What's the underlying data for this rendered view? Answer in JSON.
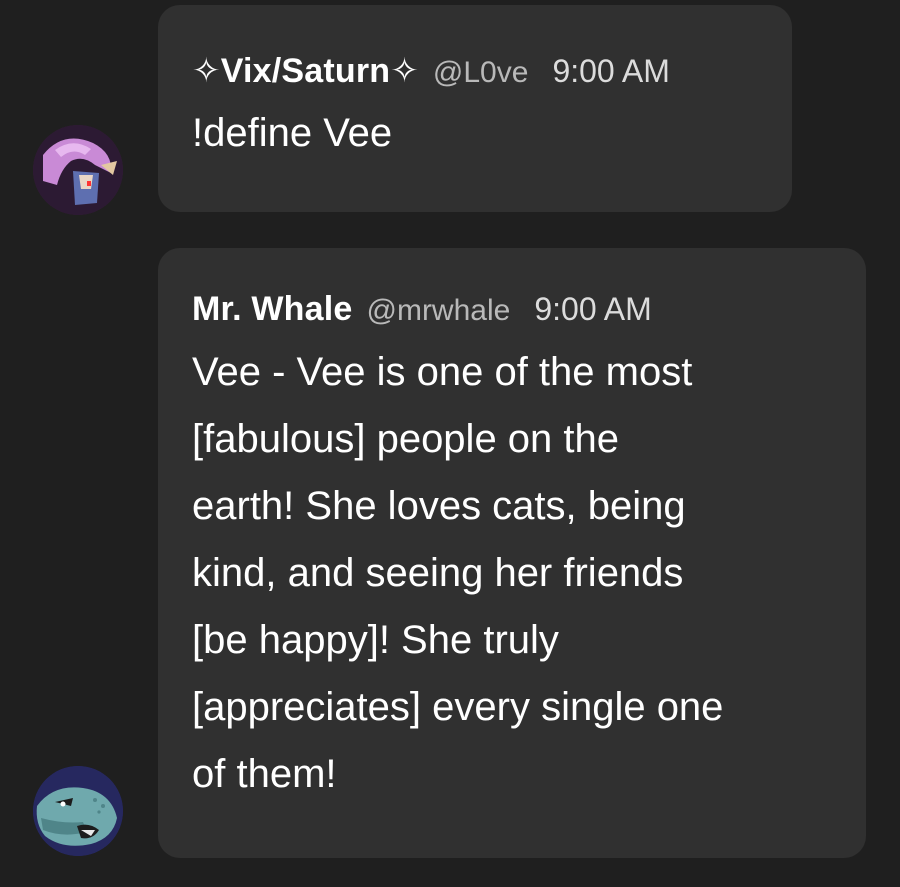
{
  "messages": [
    {
      "author": "✧Vix/Saturn✧",
      "handle": "@L0ve",
      "time": "9:00 AM",
      "content": "!define Vee",
      "avatar_icon": "pink-haired-character-avatar-icon"
    },
    {
      "author": "Mr. Whale",
      "handle": "@mrwhale",
      "time": "9:00 AM",
      "content": "Vee - Vee is one of the most\n[fabulous] people on the\nearth! She loves cats, being\nkind, and seeing her friends\n[be happy]! She truly\n[appreciates] every single one\nof them!",
      "avatar_icon": "whale-avatar-icon"
    }
  ],
  "colors": {
    "background": "#1f1f1f",
    "bubble": "#303030",
    "text": "#ffffff",
    "handle": "#b9b9b9"
  }
}
